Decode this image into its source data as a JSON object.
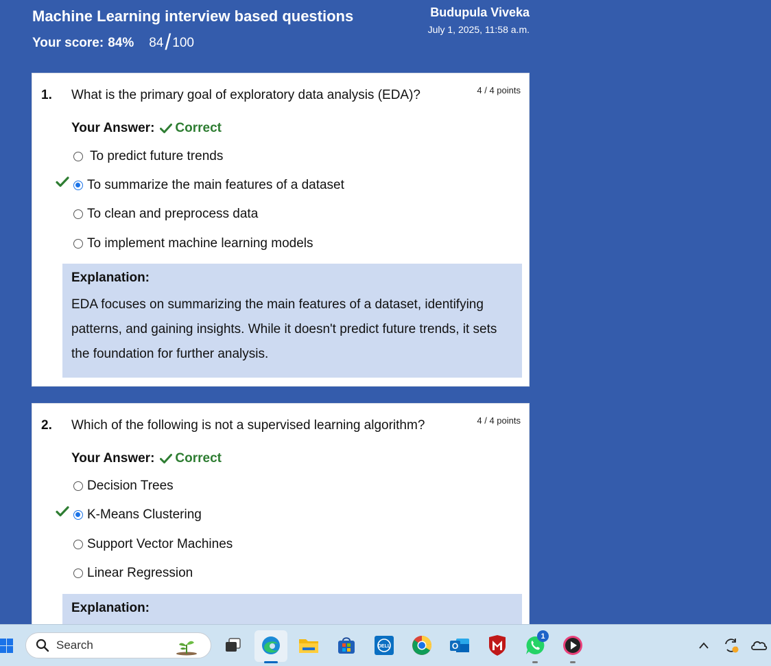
{
  "header": {
    "title": "Machine Learning interview based questions",
    "score_label": "Your score:",
    "score_percent": "84%",
    "score_value": "84",
    "score_total": "100",
    "user_name": "Budupula Viveka",
    "datetime": "July 1, 2025, 11:58 a.m."
  },
  "questions": [
    {
      "number": "1.",
      "text": "What is the primary goal of exploratory data analysis (EDA)?",
      "points": "4 / 4 points",
      "answer_label": "Your Answer:",
      "status": "Correct",
      "options": [
        {
          "label": "To predict future trends",
          "selected": false
        },
        {
          "label": "To summarize the main features of a dataset",
          "selected": true
        },
        {
          "label": "To clean and preprocess data",
          "selected": false
        },
        {
          "label": "To implement machine learning models",
          "selected": false
        }
      ],
      "explanation_title": "Explanation:",
      "explanation": "EDA focuses on summarizing the main features of a dataset, identifying patterns, and gaining insights. While it doesn't predict future trends, it sets the foundation for further analysis."
    },
    {
      "number": "2.",
      "text": "Which of the following is not a supervised learning algorithm?",
      "points": "4 / 4 points",
      "answer_label": "Your Answer:",
      "status": "Correct",
      "options": [
        {
          "label": "Decision Trees",
          "selected": false
        },
        {
          "label": "K-Means Clustering",
          "selected": true
        },
        {
          "label": "Support Vector Machines",
          "selected": false
        },
        {
          "label": "Linear Regression",
          "selected": false
        }
      ],
      "explanation_title": "Explanation:"
    }
  ],
  "taskbar": {
    "search_placeholder": "Search",
    "whatsapp_badge": "1",
    "icons": [
      "windows-start-icon",
      "search-icon",
      "task-view-icon",
      "edge-icon",
      "file-explorer-icon",
      "microsoft-store-icon",
      "dell-icon",
      "chrome-icon",
      "outlook-icon",
      "mcafee-icon",
      "whatsapp-icon",
      "media-player-icon",
      "chevron-up-icon",
      "sync-icon",
      "onedrive-icon"
    ]
  },
  "colors": {
    "page_background": "#345cac",
    "explanation_background": "#cddaf1",
    "correct_green": "#2e7d32",
    "radio_selected": "#1a73e8"
  }
}
